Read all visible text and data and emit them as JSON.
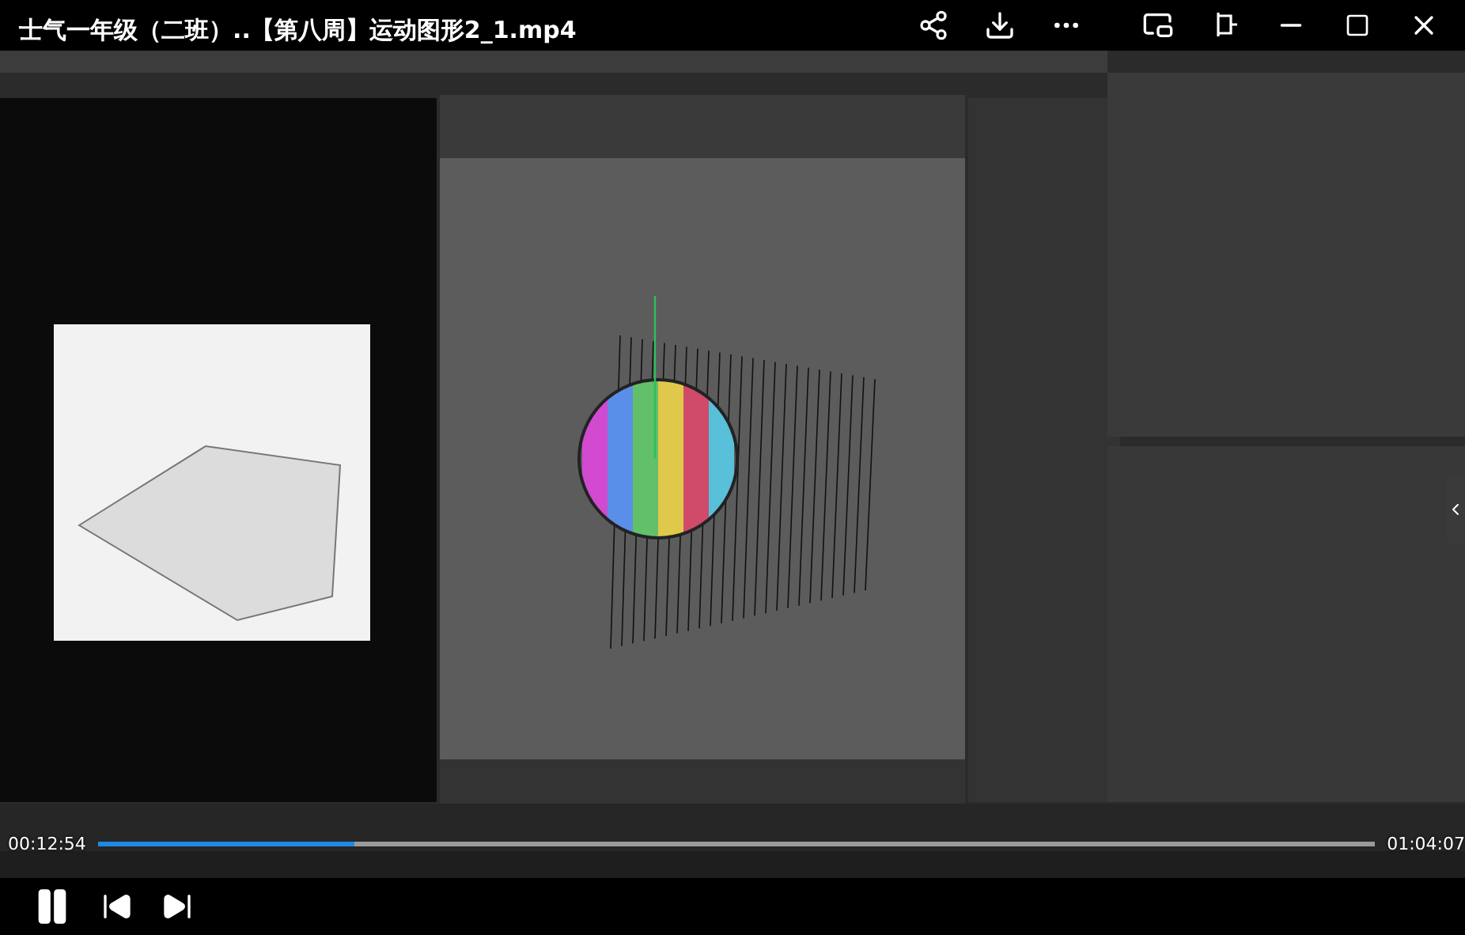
{
  "window": {
    "title": "士气一年级（二班）..【第八周】运动图形2_1.mp4"
  },
  "player": {
    "current_time": "00:12:54",
    "duration": "01:04:07",
    "progress": {
      "level": 0.201
    },
    "playing": true
  }
}
